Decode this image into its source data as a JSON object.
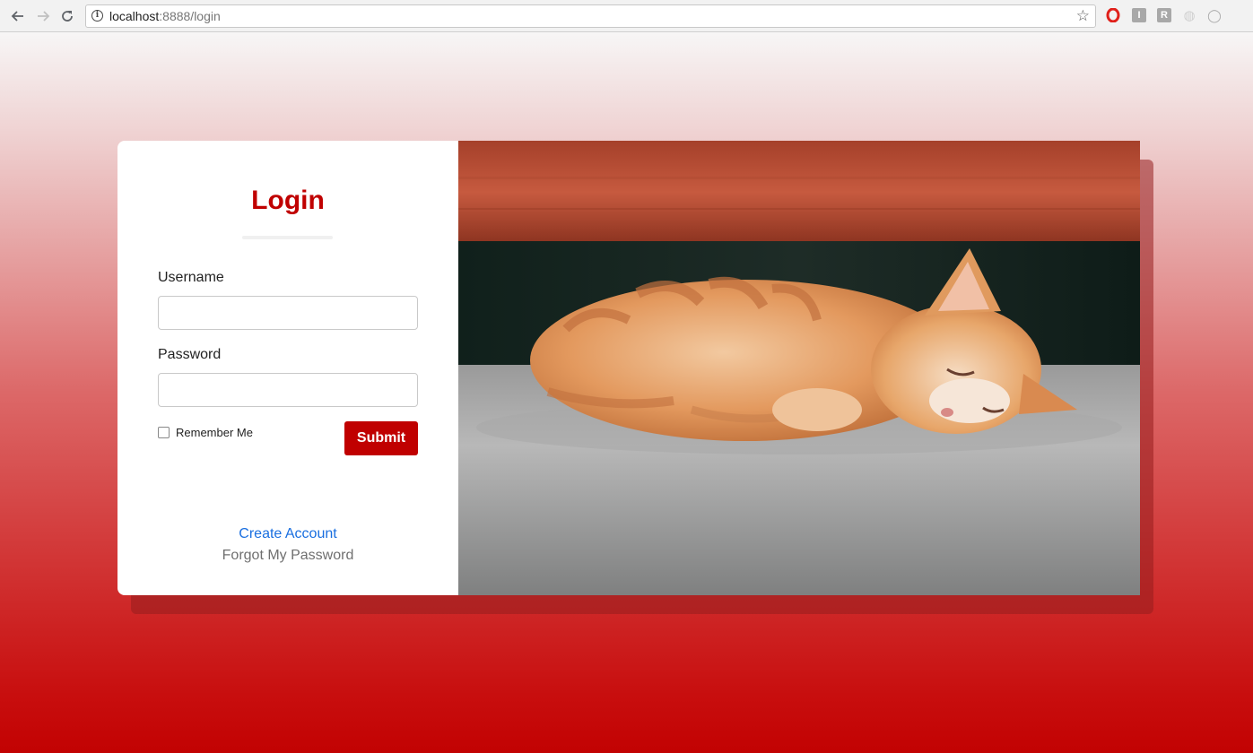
{
  "browser": {
    "url_host": "localhost",
    "url_path": ":8888/login",
    "nav": {
      "back_icon": "back-arrow-icon",
      "forward_icon": "forward-arrow-icon",
      "reload_icon": "reload-icon"
    },
    "extensions": [
      {
        "name": "opera-extension-icon",
        "glyph": "O",
        "color": "#e0201a"
      },
      {
        "name": "i-extension-icon",
        "glyph": "I",
        "color": "#9a9a9a"
      },
      {
        "name": "r-extension-icon",
        "glyph": "R",
        "color": "#9a9a9a"
      },
      {
        "name": "swirl-extension-icon",
        "glyph": "◍",
        "color": "#c8c8c8"
      },
      {
        "name": "circle-extension-icon",
        "glyph": "◯",
        "color": "#b0b0b0"
      }
    ]
  },
  "login": {
    "title": "Login",
    "username_label": "Username",
    "username_value": "",
    "password_label": "Password",
    "password_value": "",
    "remember_label": "Remember Me",
    "remember_checked": false,
    "submit_label": "Submit",
    "create_account_label": "Create Account",
    "forgot_password_label": "Forgot My Password"
  },
  "image": {
    "name": "sleeping-kitten-image"
  },
  "colors": {
    "brand": "#c00000",
    "link": "#1a6fe0",
    "muted_link": "#6f6f6f"
  }
}
